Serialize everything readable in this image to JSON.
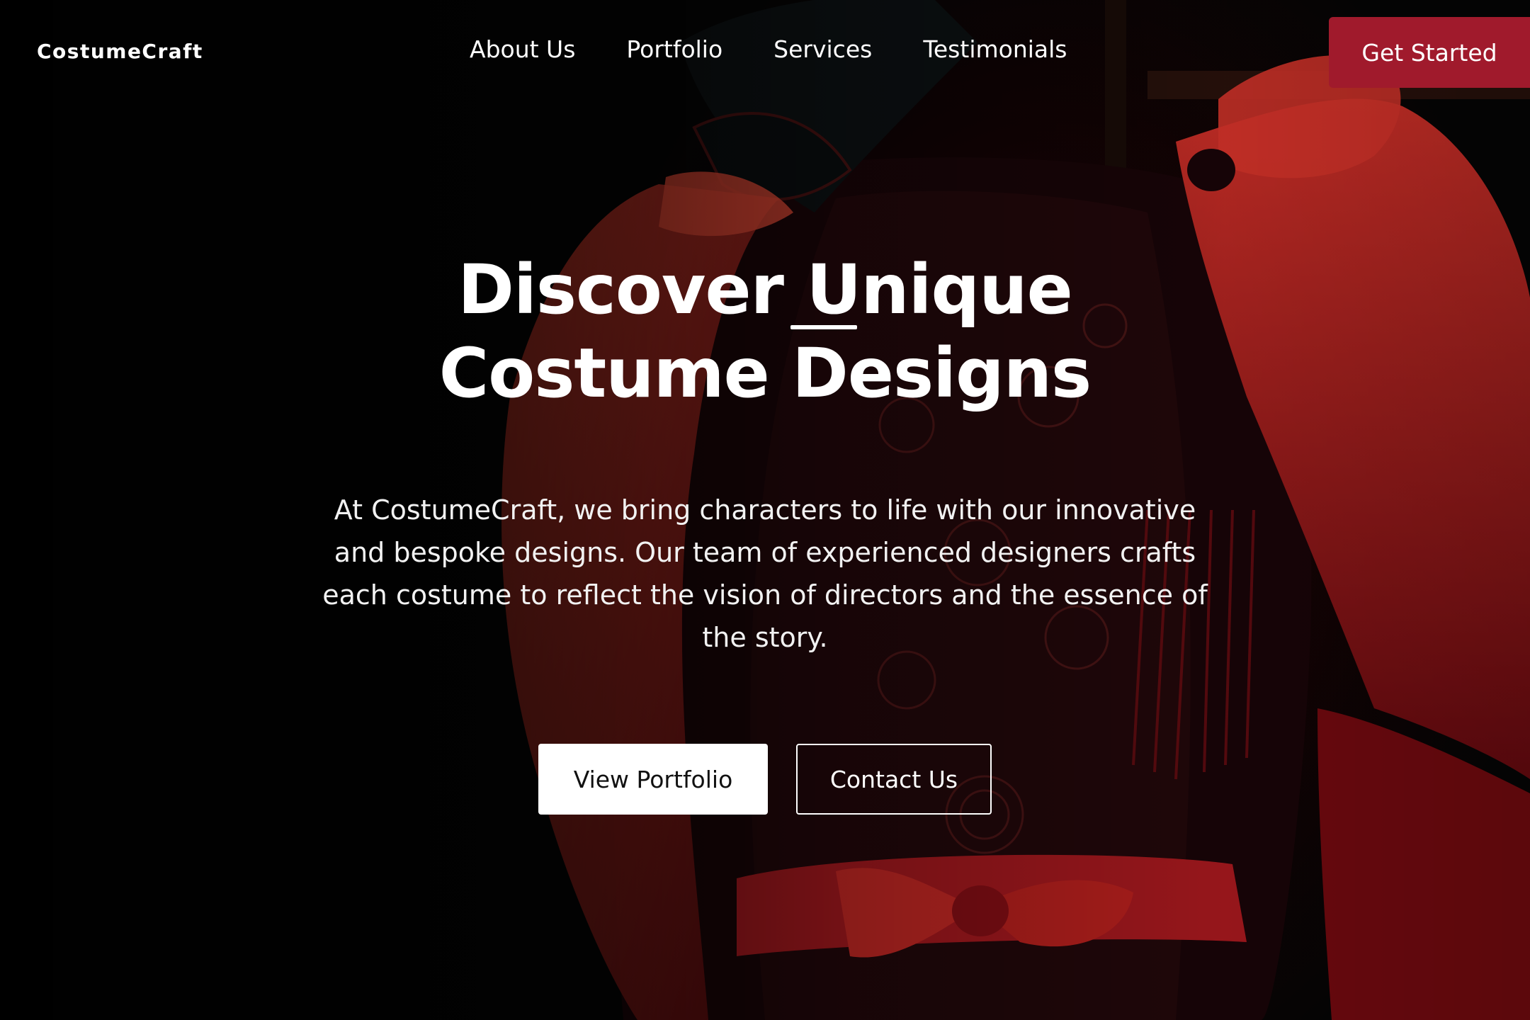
{
  "brand": {
    "name": "CostumeCraft",
    "accent_color": "#a01a2c"
  },
  "nav": {
    "links": [
      "About Us",
      "Portfolio",
      "Services",
      "Testimonials"
    ],
    "cta_label": "Get Started"
  },
  "hero": {
    "title_line_1": "Discover Unique",
    "title_line_2": "Costume Designs",
    "description": "At CostumeCraft, we bring characters to life with our innovative and bespoke designs. Our team of experienced designers crafts each costume to reflect the vision of directors and the essence of the story.",
    "primary_button": "View Portfolio",
    "secondary_button": "Contact Us",
    "background_image": "dark-red-theatrical-costume-photo"
  }
}
